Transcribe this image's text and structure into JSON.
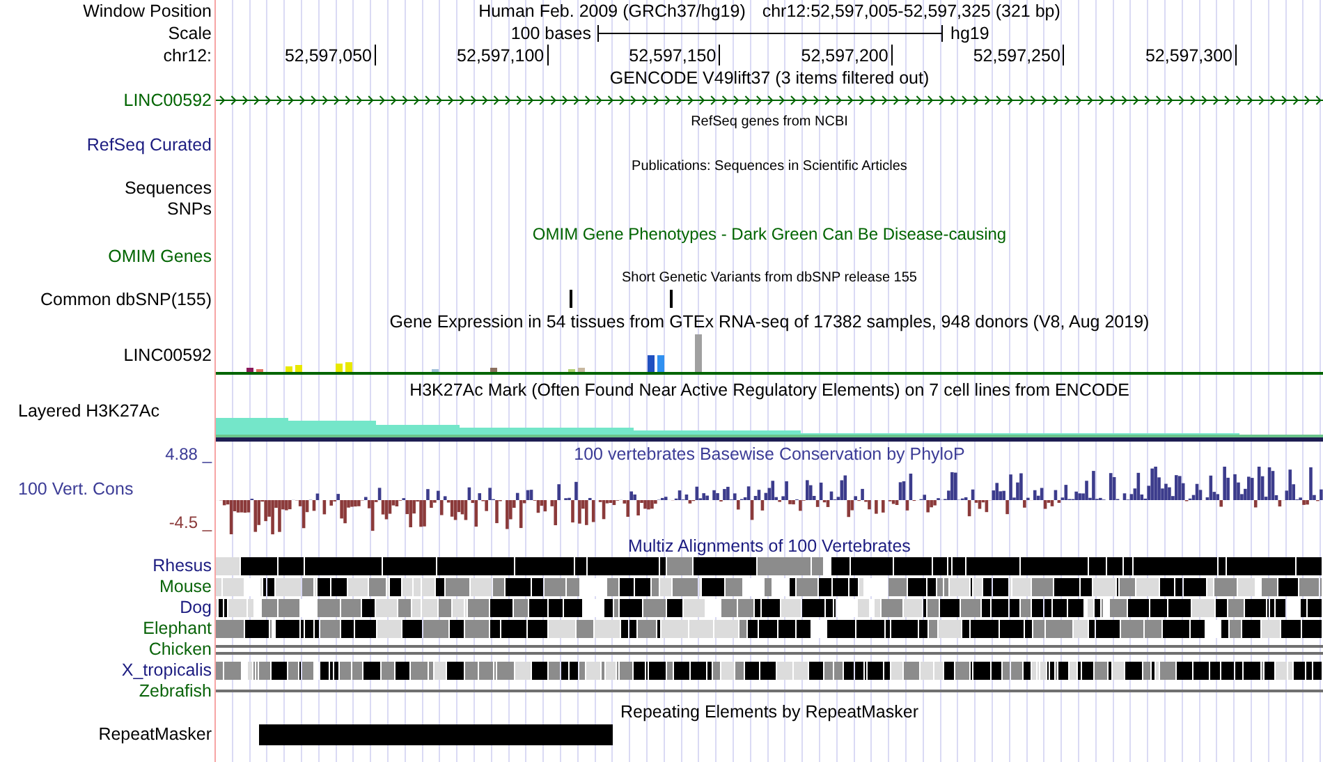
{
  "header": {
    "window_label": "Window Position",
    "title": "Human Feb. 2009 (GRCh37/hg19)",
    "position": "chr12:52,597,005-52,597,325 (321 bp)",
    "scale_label": "Scale",
    "scale_text": "100 bases",
    "assembly": "hg19",
    "chrom_label": "chr12:",
    "ticks": [
      "52,597,050",
      "52,597,100",
      "52,597,150",
      "52,597,200",
      "52,597,250",
      "52,597,300"
    ]
  },
  "tracks": [
    {
      "kind": "gene",
      "title": {
        "text": "GENCODE V49lift37 (3 items filtered out)",
        "color": "#000000"
      },
      "labels": [
        "LINC00592"
      ],
      "color": "#006400"
    },
    {
      "kind": "refseq",
      "title": {
        "text": "RefSeq genes from NCBI",
        "color": "#000000"
      },
      "labels": [
        "RefSeq Curated"
      ],
      "color": "#1c1c80"
    },
    {
      "kind": "publications",
      "title": {
        "text": "Publications: Sequences in Scientific Articles",
        "color": "#000000"
      },
      "labels": [
        "Sequences",
        "SNPs"
      ],
      "color": "#000000"
    },
    {
      "kind": "omim",
      "title": {
        "text": "OMIM Gene Phenotypes - Dark Green Can Be Disease-causing",
        "color": "#006400"
      },
      "labels": [
        "OMIM Genes"
      ],
      "color": "#006400"
    },
    {
      "kind": "snp",
      "title": {
        "text": "Short Genetic Variants from dbSNP release 155",
        "color": "#000000"
      },
      "labels": [
        "Common dbSNP(155)"
      ],
      "color": "#000000"
    },
    {
      "kind": "expression",
      "title": {
        "text": "Gene Expression in 54 tissues from GTEx RNA-seq of 17382 samples, 948 donors (V8, Aug 2019)",
        "color": "#000000"
      },
      "labels": [
        "LINC00592"
      ],
      "color": "#000000"
    },
    {
      "kind": "layered",
      "title": {
        "text": "H3K27Ac Mark (Often Found Near Active Regulatory Elements) on 7 cell lines from ENCODE",
        "color": "#000000"
      },
      "labels": [
        "Layered H3K27Ac"
      ],
      "color": "#000000"
    },
    {
      "kind": "conservation",
      "title": {
        "text": "100 vertebrates Basewise Conservation by PhyloP",
        "color": "#3c3c96"
      },
      "labels": [
        "100 Vert. Cons"
      ],
      "color": "#3c3c96",
      "ymax": "4.88 _",
      "ymin": "-4.5 _"
    },
    {
      "kind": "multiz",
      "title": {
        "text": "Multiz Alignments of 100 Vertebrates",
        "color": "#1c1c80"
      },
      "species": [
        {
          "name": "Rhesus",
          "kind": "blocks",
          "color": "#1c1c80"
        },
        {
          "name": "Mouse",
          "kind": "blocks",
          "color": "#0a640a"
        },
        {
          "name": "Dog",
          "kind": "blocks",
          "color": "#1c1c80"
        },
        {
          "name": "Elephant",
          "kind": "blocks",
          "color": "#0a640a"
        },
        {
          "name": "Chicken",
          "kind": "double-line",
          "color": "#0a640a"
        },
        {
          "name": "X_tropicalis",
          "kind": "blocks",
          "color": "#1c1c80"
        },
        {
          "name": "Zebrafish",
          "kind": "line",
          "color": "#0a640a"
        }
      ]
    },
    {
      "kind": "repeat",
      "title": {
        "text": "Repeating Elements by RepeatMasker",
        "color": "#000000"
      },
      "labels": [
        "RepeatMasker"
      ],
      "color": "#000000"
    }
  ]
}
